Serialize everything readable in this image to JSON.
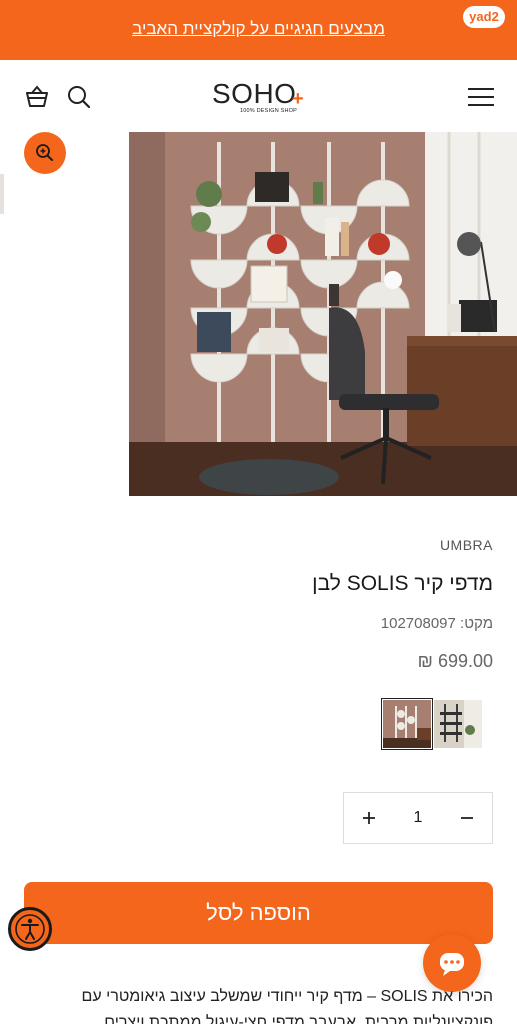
{
  "promo": {
    "text": "מבצעים חגיגיים על קולקציית האביב",
    "badge": "yad2"
  },
  "header": {
    "logo_word": "SOHO",
    "logo_plus": "+",
    "logo_tagline": "100% DESIGN SHOP",
    "icons": [
      "cart-icon",
      "search-icon",
      "menu-icon"
    ]
  },
  "product": {
    "brand": "UMBRA",
    "title": "מדפי קיר SOLIS לבן",
    "sku": "מקט: 102708097",
    "price": "₪ 699.00",
    "quantity": "1",
    "add_to_cart": "הוספה לסל",
    "description": "הכירו את SOLIS – מדף קיר ייחודי שמשלב עיצוב גיאומטרי עם פונקציונליות מרבית. אבעבר מדפי חצי-עיגול ממתכת ויצרים"
  },
  "colors": {
    "accent": "#f4661c"
  }
}
